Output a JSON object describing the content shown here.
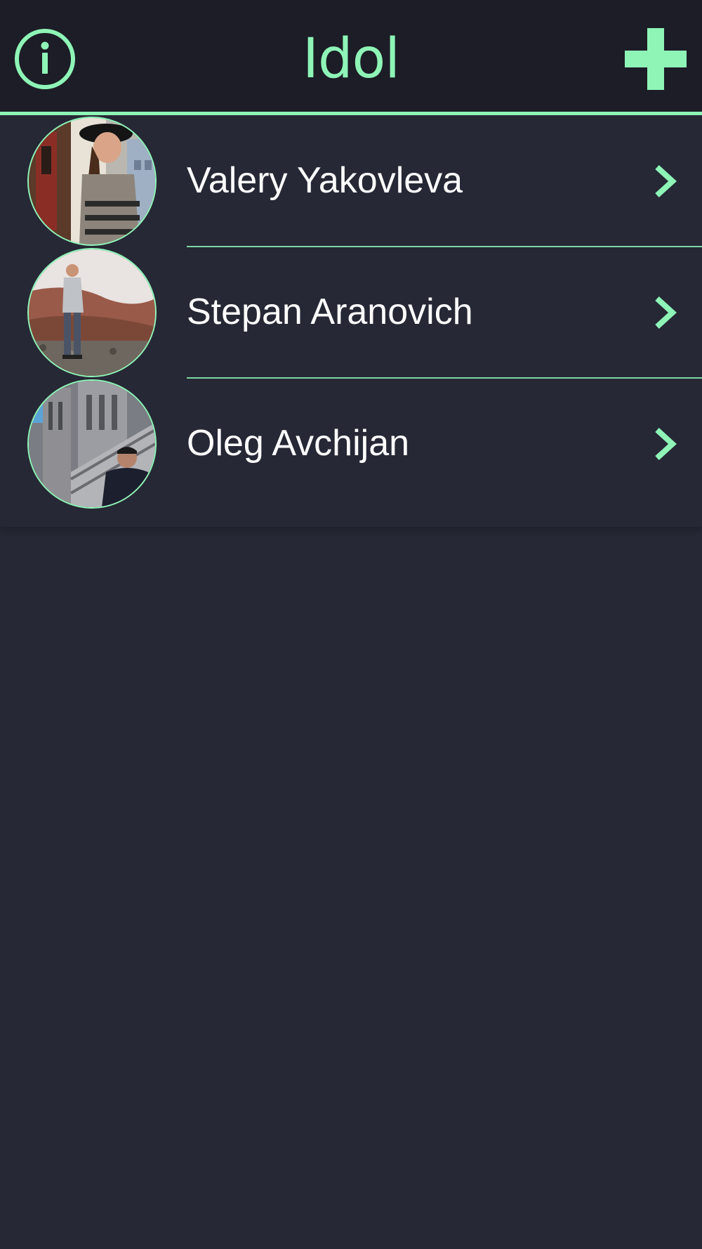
{
  "navbar": {
    "title": "Idol",
    "info_icon": "info-circle-icon",
    "add_icon": "plus-icon"
  },
  "colors": {
    "accent": "#8ef5b7",
    "navbar_bg": "#1c1d26",
    "background": "#262835",
    "text": "#ffffff"
  },
  "idols": [
    {
      "name": "Valery Yakovleva",
      "chevron_icon": "chevron-right-icon"
    },
    {
      "name": "Stepan Aranovich",
      "chevron_icon": "chevron-right-icon"
    },
    {
      "name": "Oleg Avchijan",
      "chevron_icon": "chevron-right-icon"
    }
  ]
}
